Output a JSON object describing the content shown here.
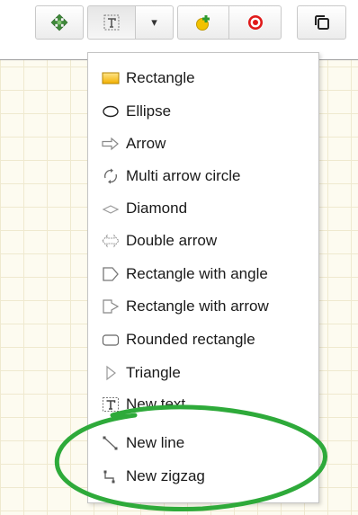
{
  "toolbar": {
    "buttons": [
      {
        "name": "move-icon"
      },
      {
        "name": "text-shape-icon"
      },
      {
        "name": "dropdown-arrow-icon",
        "glyph": "▾"
      },
      {
        "name": "add-shape-icon"
      },
      {
        "name": "target-icon"
      },
      {
        "name": "copy-icon"
      }
    ]
  },
  "menu": {
    "items": [
      {
        "label": "Rectangle",
        "icon": "rectangle-icon"
      },
      {
        "label": "Ellipse",
        "icon": "ellipse-icon"
      },
      {
        "label": "Arrow",
        "icon": "arrow-icon"
      },
      {
        "label": "Multi arrow circle",
        "icon": "multi-arrow-circle-icon"
      },
      {
        "label": "Diamond",
        "icon": "diamond-icon"
      },
      {
        "label": "Double arrow",
        "icon": "double-arrow-icon"
      },
      {
        "label": "Rectangle with angle",
        "icon": "rectangle-with-angle-icon"
      },
      {
        "label": "Rectangle with arrow",
        "icon": "rectangle-with-arrow-icon"
      },
      {
        "label": "Rounded rectangle",
        "icon": "rounded-rectangle-icon"
      },
      {
        "label": "Triangle",
        "icon": "triangle-icon"
      },
      {
        "label": "New text",
        "icon": "text-icon"
      },
      {
        "label": "New line",
        "icon": "line-icon"
      },
      {
        "label": "New zigzag",
        "icon": "zigzag-icon"
      }
    ]
  },
  "annotation": {
    "color": "#2eaa3a"
  }
}
